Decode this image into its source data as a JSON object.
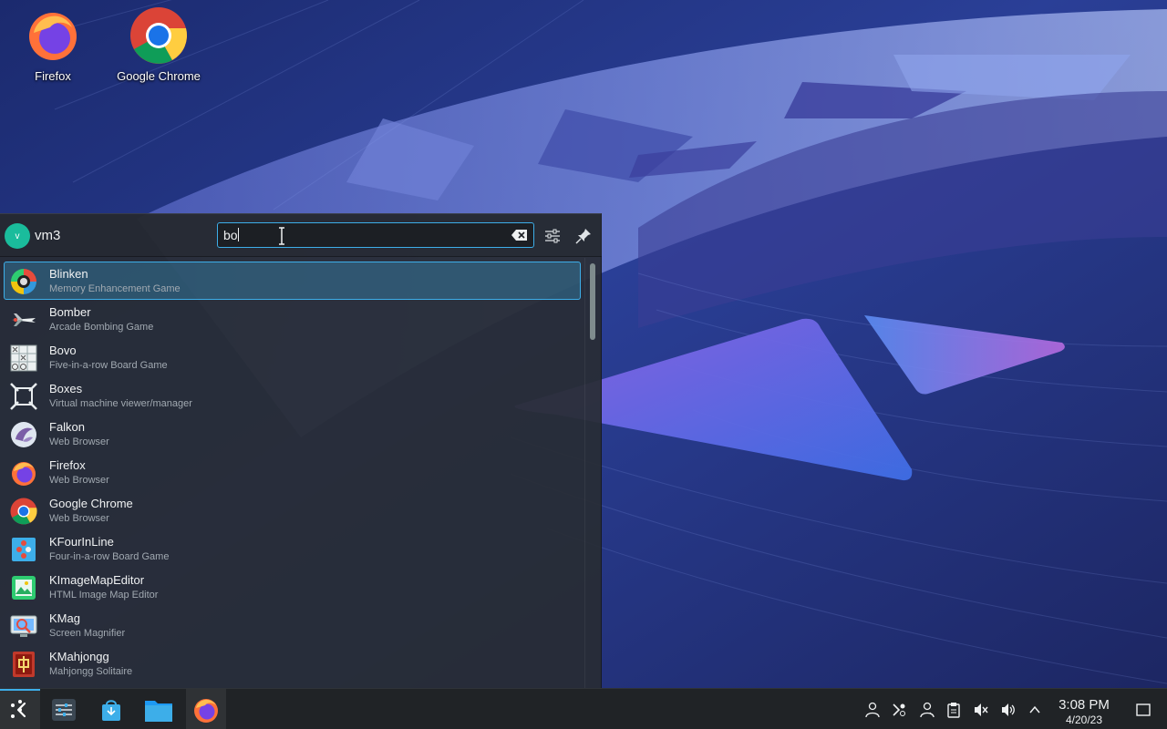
{
  "desktop": {
    "icons": [
      {
        "label": "Firefox",
        "icon": "firefox-icon"
      },
      {
        "label": "Google Chrome",
        "icon": "chrome-icon"
      }
    ]
  },
  "launcher": {
    "user": {
      "initial": "v",
      "name": "vm3"
    },
    "search": {
      "value": "bo"
    },
    "results": [
      {
        "name": "Blinken",
        "desc": "Memory Enhancement Game",
        "icon": "blinken-icon",
        "selected": true
      },
      {
        "name": "Bomber",
        "desc": "Arcade Bombing Game",
        "icon": "bomber-icon"
      },
      {
        "name": "Bovo",
        "desc": "Five-in-a-row Board Game",
        "icon": "bovo-icon"
      },
      {
        "name": "Boxes",
        "desc": "Virtual machine viewer/manager",
        "icon": "boxes-icon"
      },
      {
        "name": "Falkon",
        "desc": "Web Browser",
        "icon": "falkon-icon"
      },
      {
        "name": "Firefox",
        "desc": "Web Browser",
        "icon": "firefox-icon"
      },
      {
        "name": "Google Chrome",
        "desc": "Web Browser",
        "icon": "chrome-icon"
      },
      {
        "name": "KFourInLine",
        "desc": "Four-in-a-row Board Game",
        "icon": "kfourinline-icon"
      },
      {
        "name": "KImageMapEditor",
        "desc": "HTML Image Map Editor",
        "icon": "kimagemapeditor-icon"
      },
      {
        "name": "KMag",
        "desc": "Screen Magnifier",
        "icon": "kmag-icon"
      },
      {
        "name": "KMahjongg",
        "desc": "Mahjongg Solitaire",
        "icon": "kmahjongg-icon"
      }
    ]
  },
  "taskbar": {
    "clock": {
      "time": "3:08 PM",
      "date": "4/20/23"
    }
  },
  "colors": {
    "accent": "#3daee9",
    "panel": "#202326",
    "launcher_bg": "#282c34"
  }
}
